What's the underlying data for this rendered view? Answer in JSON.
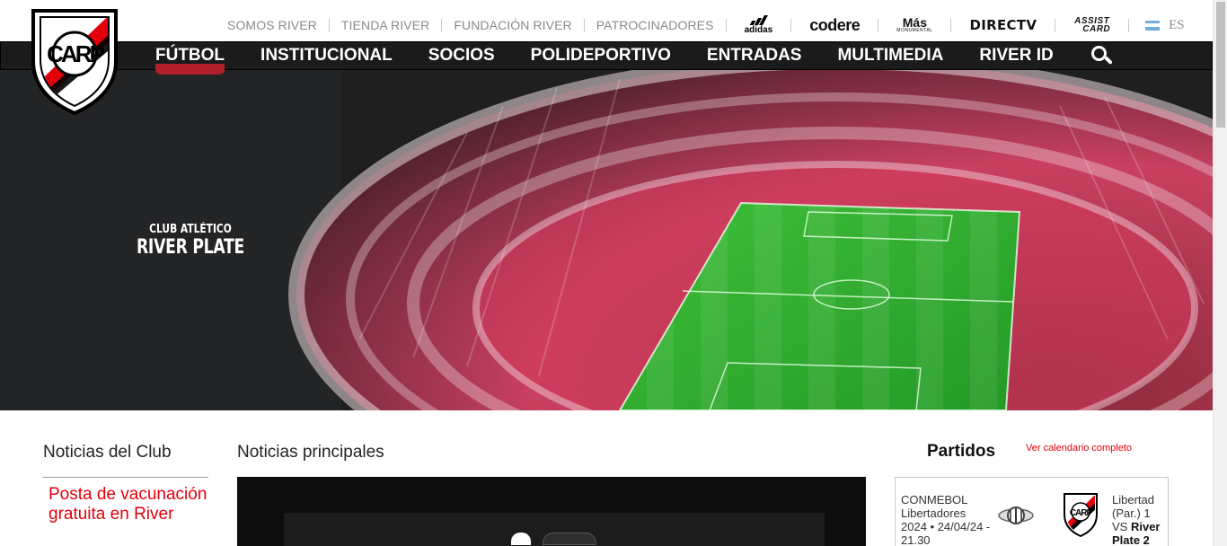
{
  "top_links": [
    "SOMOS RIVER",
    "TIENDA RIVER",
    "FUNDACIÓN RIVER",
    "PATROCINADORES"
  ],
  "sponsors": {
    "adidas": "adidas",
    "codere": "codere",
    "mas": "Más",
    "mas_sub": "MONUMENTAL",
    "directv": "DIRECTV",
    "assist_line1": "ASSIST",
    "assist_line2": "CARD"
  },
  "language": {
    "label": "ES",
    "flag_colors": [
      "#74acdf",
      "#ffffff",
      "#74acdf"
    ]
  },
  "nav": [
    {
      "label": "FÚTBOL",
      "active": true
    },
    {
      "label": "INSTITUCIONAL"
    },
    {
      "label": "SOCIOS"
    },
    {
      "label": "POLIDEPORTIVO"
    },
    {
      "label": "ENTRADAS"
    },
    {
      "label": "MULTIMEDIA"
    },
    {
      "label": "RIVER ID"
    }
  ],
  "logo": {
    "text": "CARP",
    "colors": {
      "red": "#e3000b",
      "black": "#000000",
      "white": "#ffffff"
    }
  },
  "hero": {
    "brand_small": "CLUB ATLÉTICO",
    "brand_big": "RIVER PLATE"
  },
  "club_news": {
    "heading": "Noticias del Club",
    "items": [
      "Posta de vacunación gratuita en River"
    ]
  },
  "main_news": {
    "heading": "Noticias principales"
  },
  "matches": {
    "heading": "Partidos",
    "calendar_link": "Ver calendario completo",
    "items": [
      {
        "competition": "CONMEBOL Libertadores 2024 • 24/04/24 - 21.30",
        "result_prefix": "Libertad (Par.) 1 VS ",
        "result_river": "River Plate 2"
      }
    ]
  },
  "colors": {
    "accent": "#e3000b",
    "nav_bg": "#1b1b1b",
    "active_tab": "#b21f28"
  }
}
